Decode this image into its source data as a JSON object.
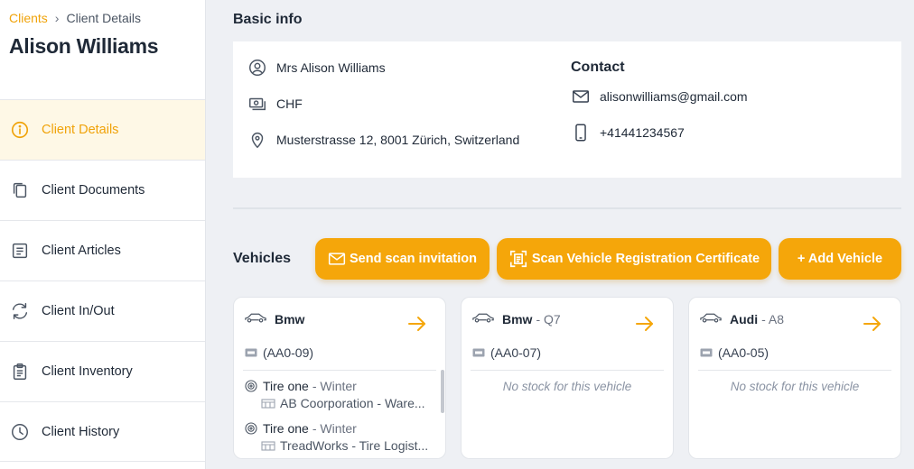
{
  "breadcrumb": {
    "link": "Clients",
    "separator": "›",
    "current": "Client Details"
  },
  "client": {
    "name": "Alison Williams"
  },
  "sidebar": {
    "items": [
      {
        "label": "Client Details",
        "icon": "info-circle-icon",
        "active": true
      },
      {
        "label": "Client Documents",
        "icon": "documents-icon",
        "active": false
      },
      {
        "label": "Client Articles",
        "icon": "articles-icon",
        "active": false
      },
      {
        "label": "Client In/Out",
        "icon": "swap-cycle-icon",
        "active": false
      },
      {
        "label": "Client Inventory",
        "icon": "clipboard-icon",
        "active": false
      },
      {
        "label": "Client History",
        "icon": "clock-icon",
        "active": false
      }
    ]
  },
  "basic_info": {
    "title": "Basic info",
    "name": "Mrs Alison Williams",
    "currency": "CHF",
    "address": "Musterstrasse 12, 8001 Zürich, Switzerland"
  },
  "contact": {
    "title": "Contact",
    "email": "alisonwilliams@gmail.com",
    "phone": "+41441234567"
  },
  "vehicles": {
    "title": "Vehicles",
    "buttons": {
      "send_scan": "Send scan invitation",
      "scan_certificate": "Scan Vehicle Registration Certificate",
      "add_vehicle": "+ Add Vehicle"
    },
    "items": [
      {
        "make": "Bmw",
        "model": "",
        "plate": "(AA0-09)",
        "stock": [
          {
            "name": "Tire one",
            "season": "- Winter",
            "location": "AB Coorporation - Ware..."
          },
          {
            "name": "Tire one",
            "season": "- Winter",
            "location": "TreadWorks - Tire Logist..."
          }
        ],
        "empty_text": ""
      },
      {
        "make": "Bmw",
        "model": "- Q7",
        "plate": "(AA0-07)",
        "stock": [],
        "empty_text": "No stock for this vehicle"
      },
      {
        "make": "Audi",
        "model": "- A8",
        "plate": "(AA0-05)",
        "stock": [],
        "empty_text": "No stock for this vehicle"
      }
    ]
  },
  "colors": {
    "accent": "#f5a60a",
    "active_bg": "#fef8e6",
    "page_bg": "#eef0f4"
  }
}
